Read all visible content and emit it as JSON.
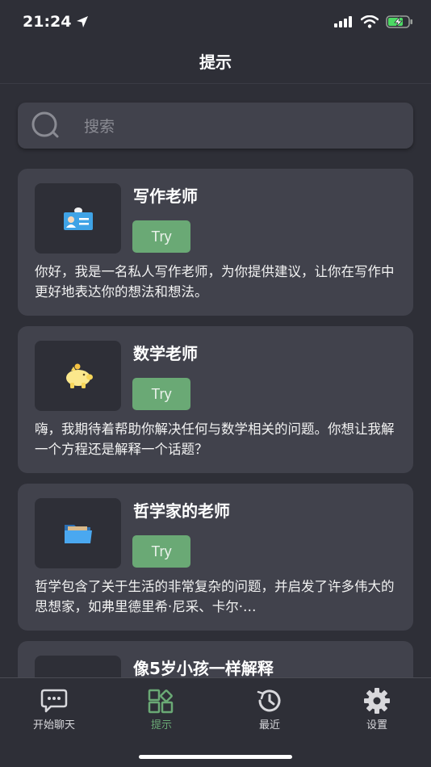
{
  "status_bar": {
    "time": "21:24"
  },
  "nav": {
    "title": "提示"
  },
  "search": {
    "placeholder": "搜索"
  },
  "cards": [
    {
      "title": "写作老师",
      "try_label": "Try",
      "description": "你好，我是一名私人写作老师，为你提供建议，让你在写作中更好地表达你的想法和想法。",
      "icon": "id-card-icon"
    },
    {
      "title": "数学老师",
      "try_label": "Try",
      "description": "嗨，我期待着帮助你解决任何与数学相关的问题。你想让我解一个方程还是解释一个话题？",
      "icon": "piggy-bank-icon"
    },
    {
      "title": "哲学家的老师",
      "try_label": "Try",
      "description": "哲学包含了关于生活的非常复杂的问题，并启发了许多伟大的思想家，如弗里德里希·尼采、卡尔·…",
      "icon": "folder-icon"
    },
    {
      "title": "像5岁小孩一样解释"
    }
  ],
  "tabs": [
    {
      "label": "开始聊天",
      "icon": "chat-icon"
    },
    {
      "label": "提示",
      "icon": "widgets-icon"
    },
    {
      "label": "最近",
      "icon": "history-icon"
    },
    {
      "label": "设置",
      "icon": "gear-icon"
    }
  ],
  "colors": {
    "background": "#2e2f37",
    "card": "#41424c",
    "accent": "#6aa975"
  }
}
